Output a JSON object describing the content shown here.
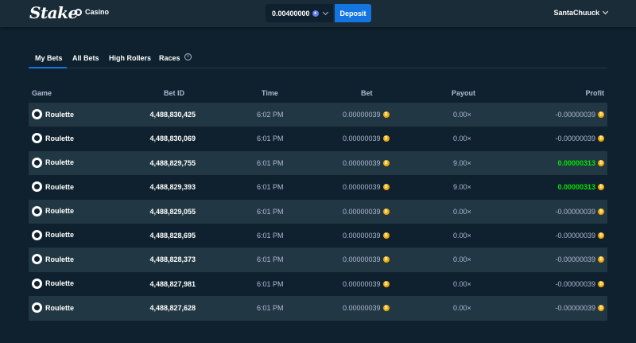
{
  "header": {
    "logo": "Stake",
    "section": "Casino",
    "balance": "0.00400000",
    "deposit_label": "Deposit",
    "username": "SantaChuuck"
  },
  "tabs": [
    {
      "label": "My Bets",
      "active": true
    },
    {
      "label": "All Bets",
      "active": false
    },
    {
      "label": "High Rollers",
      "active": false
    },
    {
      "label": "Races",
      "active": false
    }
  ],
  "columns": {
    "game": "Game",
    "bet_id": "Bet ID",
    "time": "Time",
    "bet": "Bet",
    "payout": "Payout",
    "profit": "Profit"
  },
  "rows": [
    {
      "game": "Roulette",
      "bet_id": "4,488,830,425",
      "time": "6:02 PM",
      "bet": "0.00000039",
      "payout": "0.00×",
      "profit": "-0.00000039",
      "win": false
    },
    {
      "game": "Roulette",
      "bet_id": "4,488,830,069",
      "time": "6:01 PM",
      "bet": "0.00000039",
      "payout": "0.00×",
      "profit": "-0.00000039",
      "win": false
    },
    {
      "game": "Roulette",
      "bet_id": "4,488,829,755",
      "time": "6:01 PM",
      "bet": "0.00000039",
      "payout": "9.00×",
      "profit": "0.00000313",
      "win": true
    },
    {
      "game": "Roulette",
      "bet_id": "4,488,829,393",
      "time": "6:01 PM",
      "bet": "0.00000039",
      "payout": "9.00×",
      "profit": "0.00000313",
      "win": true
    },
    {
      "game": "Roulette",
      "bet_id": "4,488,829,055",
      "time": "6:01 PM",
      "bet": "0.00000039",
      "payout": "0.00×",
      "profit": "-0.00000039",
      "win": false
    },
    {
      "game": "Roulette",
      "bet_id": "4,488,828,695",
      "time": "6:01 PM",
      "bet": "0.00000039",
      "payout": "0.00×",
      "profit": "-0.00000039",
      "win": false
    },
    {
      "game": "Roulette",
      "bet_id": "4,488,828,373",
      "time": "6:01 PM",
      "bet": "0.00000039",
      "payout": "0.00×",
      "profit": "-0.00000039",
      "win": false
    },
    {
      "game": "Roulette",
      "bet_id": "4,488,827,981",
      "time": "6:01 PM",
      "bet": "0.00000039",
      "payout": "0.00×",
      "profit": "-0.00000039",
      "win": false
    },
    {
      "game": "Roulette",
      "bet_id": "4,488,827,628",
      "time": "6:01 PM",
      "bet": "0.00000039",
      "payout": "0.00×",
      "profit": "-0.00000039",
      "win": false
    }
  ],
  "colors": {
    "background": "#0f212e",
    "header": "#1a2c38",
    "row_alt": "#213743",
    "accent": "#1475e1",
    "win": "#00e701",
    "coin": "#f2a900"
  },
  "icons": {
    "currency": "ethereum-icon",
    "coin": "btc-coin-icon",
    "game": "roulette-wheel-icon",
    "info": "info-icon"
  }
}
